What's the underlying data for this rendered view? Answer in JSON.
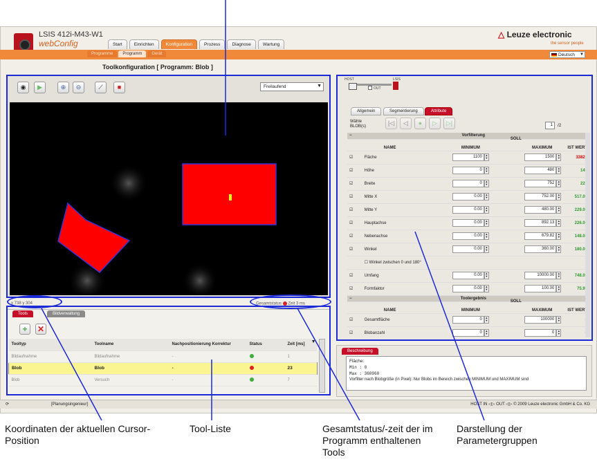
{
  "app": {
    "title": "LSIS 412i-M43-W1",
    "subtitle": "webConfig",
    "brand": "Leuze electronic",
    "brand_mark": "△",
    "tagline": "the sensor people",
    "language": "Deutsch"
  },
  "nav": {
    "tabs": [
      "Start",
      "Einrichten",
      "Konfiguration",
      "Prozess",
      "Diagnose",
      "Wartung"
    ],
    "active": "Konfiguration",
    "subtabs": [
      "Programme",
      "Programm",
      "Gerät"
    ],
    "active_sub": "Programm"
  },
  "page_title": "Toolkonfiguration   [ Programm: Blob ]",
  "toolbar": {
    "mode_select": "Freilaufend",
    "icons": [
      "camera-icon",
      "play-icon",
      "zoom-in-icon",
      "zoom-out-icon",
      "tool-icon",
      "save-icon"
    ]
  },
  "image": {
    "coords": "x 738 y 304",
    "total_status_label": "Gesamtstatus",
    "total_status_color": "#d22",
    "total_time_label": "Zeit",
    "total_time": "3 ms"
  },
  "tool_tabs": {
    "active": "Tools",
    "other": "Bildverwaltung"
  },
  "tool_table": {
    "headers": [
      "Tooltyp",
      "Toolname",
      "Nachpositionierung Korrektur",
      "Status",
      "Zeit [ms]"
    ],
    "rows": [
      {
        "type": "Bildaufnahme",
        "name": "Bildaufnahme",
        "corr": "-",
        "status": "#3ab03a",
        "time": "1"
      },
      {
        "type": "Blob",
        "name": "Blob",
        "corr": "-",
        "status": "#d22",
        "time": "23"
      },
      {
        "type": "Blob",
        "name": "Versuch",
        "corr": "-",
        "status": "#3ab03a",
        "time": "7"
      }
    ],
    "selected_index": 1
  },
  "host": {
    "host_label": "HOST",
    "lsis_label": "LSIS",
    "out_label": "OUT"
  },
  "right_tabs": [
    "Allgemein",
    "Segmentierung",
    "Attribute"
  ],
  "right_active": "Attribute",
  "blob_select": {
    "label": "Wähle BLOB(s)",
    "current": "1",
    "total": "/2"
  },
  "params": {
    "group1": "Vorfilterung",
    "soll": "SOLL",
    "headers": [
      "NAME",
      "MINIMUM",
      "MAXIMUM",
      "IST WERT"
    ],
    "rows": [
      {
        "name": "Fläche",
        "min": "1100",
        "max": "1500",
        "ist": "33823",
        "ok": false
      },
      {
        "name": "Höhe",
        "min": "0",
        "max": "480",
        "ist": "149",
        "ok": true
      },
      {
        "name": "Breite",
        "min": "0",
        "max": "752",
        "ist": "227",
        "ok": true
      },
      {
        "name": "Mitte X",
        "min": "0.00",
        "max": "752.00",
        "ist": "517.00",
        "ok": true
      },
      {
        "name": "Mitte Y",
        "min": "0.00",
        "max": "480.00",
        "ist": "229.00",
        "ok": true
      },
      {
        "name": "Hauptachse",
        "min": "0.00",
        "max": "892.13",
        "ist": "226.00",
        "ok": true
      },
      {
        "name": "Nebenachse",
        "min": "0.00",
        "max": "679.82",
        "ist": "148.00",
        "ok": true
      },
      {
        "name": "Winkel",
        "min": "0.00",
        "max": "360.00",
        "ist": "180.00",
        "ok": true
      }
    ],
    "angle_option": "Winkel zwischen 0 und 180°",
    "rows2": [
      {
        "name": "Umfang",
        "min": "0.00",
        "max": "10000.00",
        "ist": "748.00",
        "ok": true
      },
      {
        "name": "Formfaktor",
        "min": "0.00",
        "max": "100.00",
        "ist": "75.97",
        "ok": true
      }
    ],
    "group2": "Toolergebnis",
    "rows3": [
      {
        "name": "Gesamtfläche",
        "min": "0",
        "max": "100000",
        "ist": "0",
        "ok": true
      },
      {
        "name": "Blobanzahl",
        "min": "0",
        "max": "0",
        "ist": "0",
        "ok": true
      }
    ]
  },
  "description": {
    "tab": "Beschreibung",
    "title": "Fläche:",
    "min": "Min : 0",
    "max": "Max : 360960",
    "text": "Vorfilter nach Blobgröße (in Pixel): Nur Blobs im Bereich zwischen MINIMUM und MAXIMUM sind"
  },
  "statusbar": {
    "left": "[Planungsingenieur]",
    "right": "HOST IN ◁▷ OUT ◁▷  © 2009 Leuze electronic GmbH & Co. KG"
  },
  "callouts": {
    "coords": "Koordinaten der aktuellen Cursor-Position",
    "toollist": "Tool-Liste",
    "total": "Gesamtstatus/-zeit der im Programm enthaltenen Tools",
    "params": "Darstellung der Parametergruppen"
  }
}
